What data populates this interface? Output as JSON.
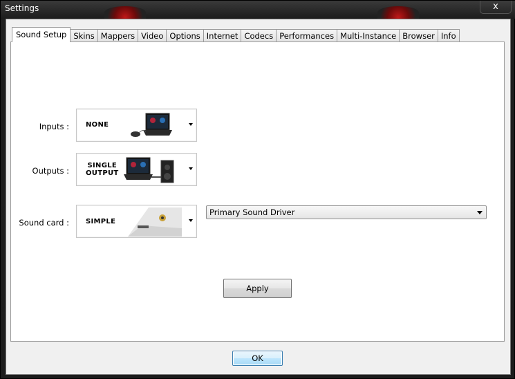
{
  "window": {
    "title": "Settings",
    "close_label": "x"
  },
  "tabs": [
    {
      "label": "Sound Setup",
      "active": true
    },
    {
      "label": "Skins"
    },
    {
      "label": "Mappers"
    },
    {
      "label": "Video"
    },
    {
      "label": "Options"
    },
    {
      "label": "Internet"
    },
    {
      "label": "Codecs"
    },
    {
      "label": "Performances"
    },
    {
      "label": "Multi-Instance"
    },
    {
      "label": "Browser"
    },
    {
      "label": "Info"
    }
  ],
  "sound_setup": {
    "inputs": {
      "label": "Inputs :",
      "value": "NONE",
      "image_icon": "laptop-with-mouse-icon"
    },
    "outputs": {
      "label": "Outputs :",
      "value_line1": "SINGLE",
      "value_line2": "OUTPUT",
      "image_icon": "laptop-with-speaker-icon"
    },
    "sound_card": {
      "label": "Sound card :",
      "value": "SIMPLE",
      "image_icon": "laptop-audio-jack-icon"
    },
    "driver_dropdown": {
      "selected": "Primary Sound Driver"
    },
    "apply_label": "Apply"
  },
  "footer": {
    "ok_label": "OK"
  },
  "colors": {
    "frame": "#1c1c1c",
    "client_bg": "#f0f0f0",
    "panel_bg": "#ffffff",
    "default_button_border": "#3c7fb1"
  }
}
